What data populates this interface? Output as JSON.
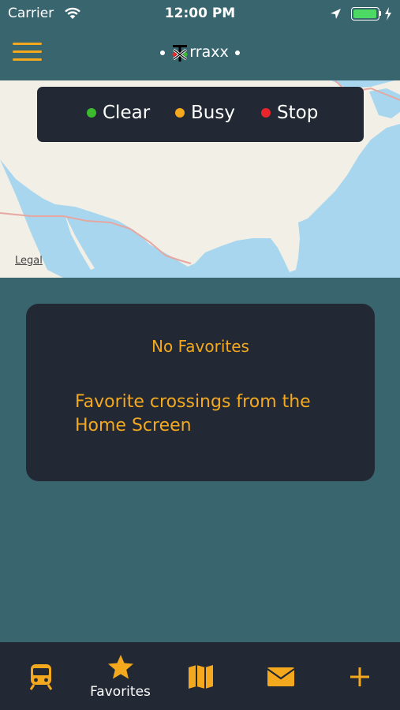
{
  "status": {
    "carrier": "Carrier",
    "time": "12:00 PM"
  },
  "nav": {
    "title": "rraxx"
  },
  "map": {
    "legal": "Legal"
  },
  "legend": {
    "items": [
      {
        "label": "Clear",
        "color": "#3dbb2f"
      },
      {
        "label": "Busy",
        "color": "#f4a81d"
      },
      {
        "label": "Stop",
        "color": "#e8262b"
      }
    ]
  },
  "favorites": {
    "empty_title": "No Favorites",
    "empty_message": "Favorite crossings from the Home Screen"
  },
  "tabs": [
    {
      "icon": "train-icon",
      "label": ""
    },
    {
      "icon": "star-icon",
      "label": "Favorites",
      "selected": true
    },
    {
      "icon": "map-icon",
      "label": ""
    },
    {
      "icon": "envelope-icon",
      "label": ""
    },
    {
      "icon": "plus-icon",
      "label": ""
    }
  ],
  "colors": {
    "accent": "#f4a81d",
    "background": "#39656f",
    "panel": "#222934"
  }
}
